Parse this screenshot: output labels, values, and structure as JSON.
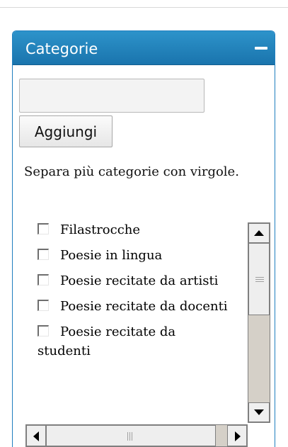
{
  "panel": {
    "title": "Categorie",
    "collapse_icon": "minus-icon"
  },
  "add_form": {
    "input_value": "",
    "input_placeholder": "",
    "button_label": "Aggiungi",
    "hint": "Separa più categorie con virgole."
  },
  "categories": {
    "items": [
      {
        "label": "Filastrocche",
        "checked": false
      },
      {
        "label": "Poesie in lingua",
        "checked": false
      },
      {
        "label": "Poesie recitate da artisti",
        "checked": false
      },
      {
        "label": "Poesie recitate da docenti",
        "checked": false
      },
      {
        "label": "Poesie recitate da studenti",
        "checked": false
      }
    ]
  },
  "colors": {
    "header_bg": "#2d93ca",
    "header_text": "#ffffff",
    "scrollbar_track": "#d5d0c8"
  },
  "icons": {
    "scroll_up": "triangle-up-icon",
    "scroll_down": "triangle-down-icon",
    "scroll_left": "triangle-left-icon",
    "scroll_right": "triangle-right-icon"
  }
}
